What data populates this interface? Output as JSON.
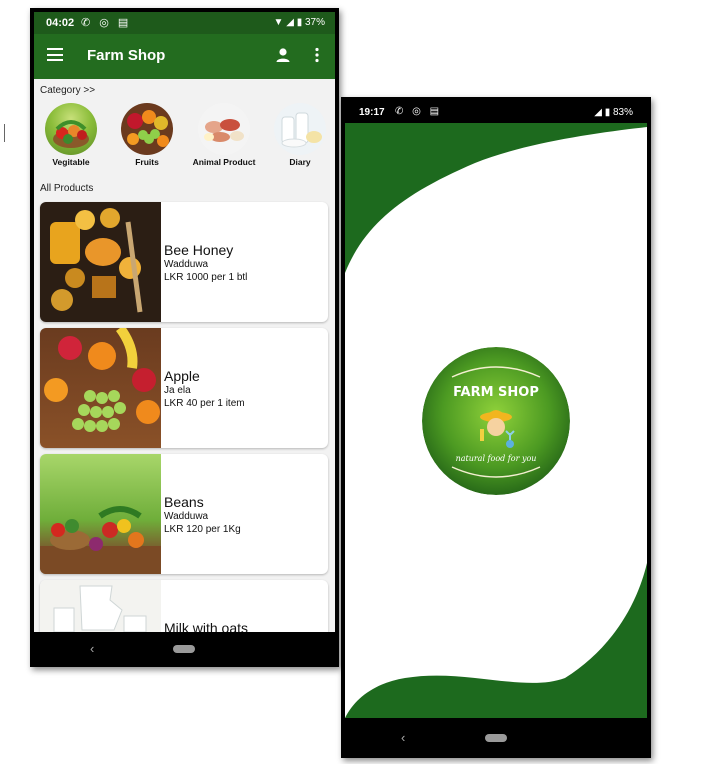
{
  "phone1": {
    "status": {
      "time": "04:02",
      "battery": "37%"
    },
    "appbar": {
      "title": "Farm Shop"
    },
    "category_label": "Category >>",
    "categories": [
      {
        "label": "Vegitable"
      },
      {
        "label": "Fruits"
      },
      {
        "label": "Animal Product"
      },
      {
        "label": "Diary"
      }
    ],
    "all_products_label": "All Products",
    "products": [
      {
        "name": "Bee Honey",
        "location": "Wadduwa",
        "price": "LKR 1000 per 1 btl"
      },
      {
        "name": "Apple",
        "location": "Ja ela",
        "price": "LKR 40 per 1 item"
      },
      {
        "name": "Beans",
        "location": "Wadduwa",
        "price": "LKR 120 per 1Kg"
      },
      {
        "name": "Milk with oats",
        "location": "",
        "price": ""
      }
    ],
    "nav": {
      "back": "‹"
    }
  },
  "phone2": {
    "status": {
      "time": "19:17",
      "battery": "83%"
    },
    "logo": {
      "title": "FARM SHOP",
      "tagline": "natural food for you"
    },
    "nav": {
      "back": "‹"
    }
  },
  "colors": {
    "primary_dark": "#1e5a1b",
    "primary": "#236c1f",
    "splash_green": "#1d6a1e"
  }
}
